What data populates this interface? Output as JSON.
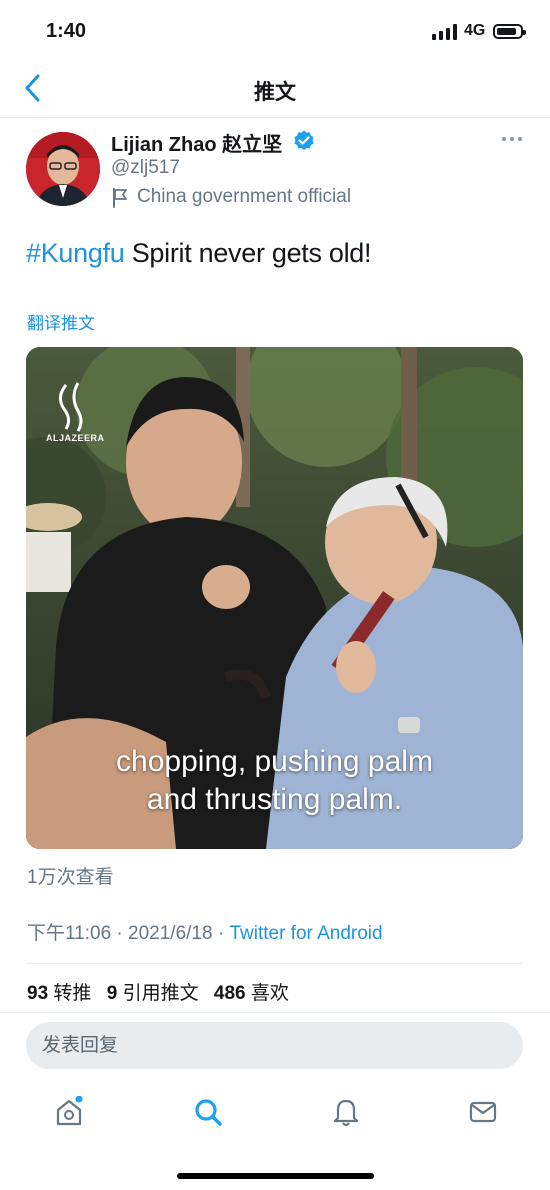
{
  "status_bar": {
    "time": "1:40",
    "network": "4G"
  },
  "nav": {
    "title": "推文"
  },
  "author": {
    "name": "Lijian Zhao 赵立坚",
    "handle": "@zlj517",
    "label": "China government official"
  },
  "tweet": {
    "hashtag": "#Kungfu",
    "text": " Spirit never gets old!",
    "translate_label": "翻译推文"
  },
  "media": {
    "logo": "ALJAZEERA",
    "caption_line1": "chopping, pushing palm",
    "caption_line2": "and thrusting palm."
  },
  "views": "1万次查看",
  "meta": {
    "time": "下午11:06",
    "date": "2021/6/18",
    "sep": " · ",
    "source": "Twitter for Android"
  },
  "stats": {
    "retweets": "93",
    "retweets_label": "转推",
    "quotes": "9",
    "quotes_label": "引用推文",
    "likes": "486",
    "likes_label": "喜欢"
  },
  "reply": {
    "placeholder": "发表回复"
  },
  "colors": {
    "accent": "#1b95e0",
    "muted": "#657786"
  },
  "tabbar": [
    "home-icon",
    "search-icon",
    "notifications-icon",
    "messages-icon"
  ]
}
